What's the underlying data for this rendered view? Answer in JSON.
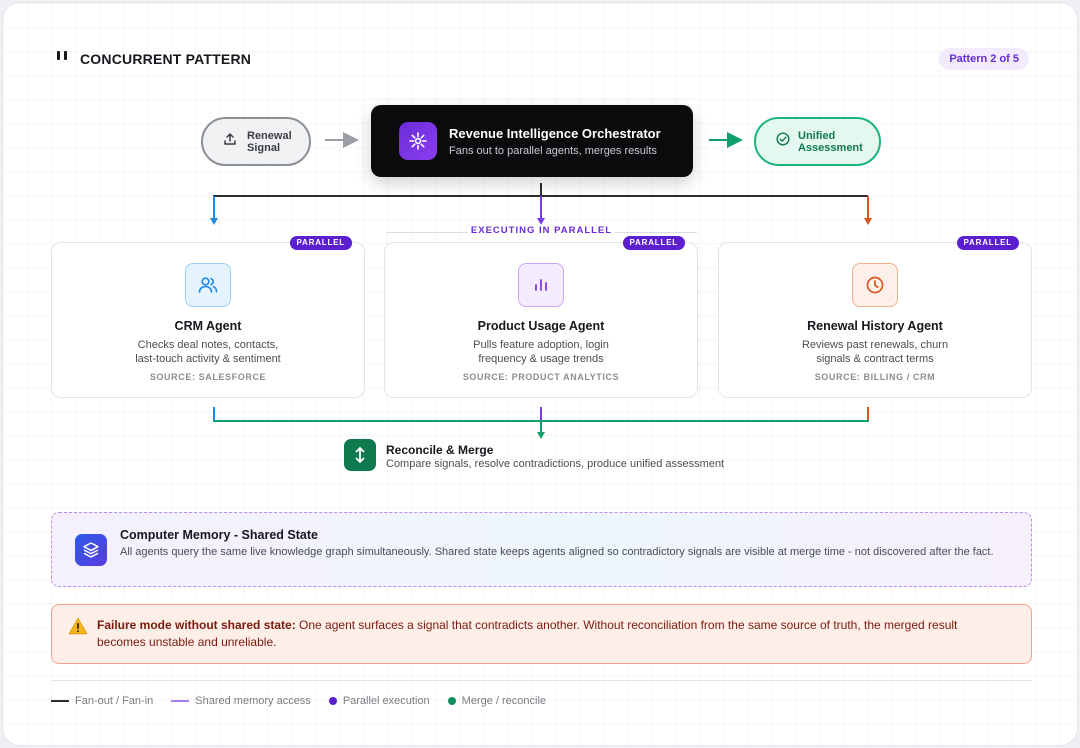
{
  "header": {
    "title": "CONCURRENT PATTERN",
    "pattern_badge": "Pattern 2 of 5"
  },
  "flow": {
    "input": {
      "line1": "Renewal",
      "line2": "Signal",
      "icon": "upload-icon"
    },
    "orchestrator": {
      "title": "Revenue Intelligence Orchestrator",
      "subtitle": "Fans out to parallel agents, merges results",
      "icon": "sparkle-icon"
    },
    "output": {
      "line1": "Unified",
      "line2": "Assessment",
      "icon": "check-circle-icon"
    },
    "parallel_label": "EXECUTING IN PARALLEL"
  },
  "agents": [
    {
      "badge": "PARALLEL",
      "name": "CRM Agent",
      "desc_line1": "Checks deal notes, contacts,",
      "desc_line2": "last-touch activity & sentiment",
      "source": "SOURCE: SALESFORCE",
      "icon": "users-icon",
      "color": "#1e88e5"
    },
    {
      "badge": "PARALLEL",
      "name": "Product Usage Agent",
      "desc_line1": "Pulls feature adoption, login",
      "desc_line2": "frequency & usage trends",
      "source": "SOURCE: PRODUCT ANALYTICS",
      "icon": "bar-chart-icon",
      "color": "#7c3aed"
    },
    {
      "badge": "PARALLEL",
      "name": "Renewal History Agent",
      "desc_line1": "Reviews past renewals, churn",
      "desc_line2": "signals & contract terms",
      "source": "SOURCE: BILLING / CRM",
      "icon": "clock-icon",
      "color": "#d9541e"
    }
  ],
  "merge": {
    "title": "Reconcile & Merge",
    "subtitle": "Compare signals, resolve contradictions, produce unified assessment",
    "icon": "vertical-arrows-icon"
  },
  "memory": {
    "title": "Computer Memory - Shared State",
    "body": "All agents query the same live knowledge graph simultaneously. Shared state keeps agents aligned so contradictory signals are visible at merge time - not discovered after the fact.",
    "icon": "layers-icon"
  },
  "failure": {
    "label": "Failure mode without shared state:",
    "text": " One agent surfaces a signal that contradicts another. Without reconciliation from the same source of truth, the merged result becomes unstable and unreliable.",
    "icon": "warning-icon"
  },
  "legend": [
    {
      "label": "Fan-out / Fan-in",
      "kind": "line",
      "color": "#2b2d31"
    },
    {
      "label": "Shared memory access",
      "kind": "line",
      "color": "#a87ef0"
    },
    {
      "label": "Parallel execution",
      "kind": "dot",
      "color": "#5b1fcf"
    },
    {
      "label": "Merge / reconcile",
      "kind": "dot",
      "color": "#0f8f5c"
    }
  ],
  "colors": {
    "accent": "#6a2bd9",
    "merge": "#0f7a4d",
    "crm": "#1e88e5",
    "usage": "#7c3aed",
    "renewal": "#d9541e",
    "failure": "#7a1b0e"
  }
}
